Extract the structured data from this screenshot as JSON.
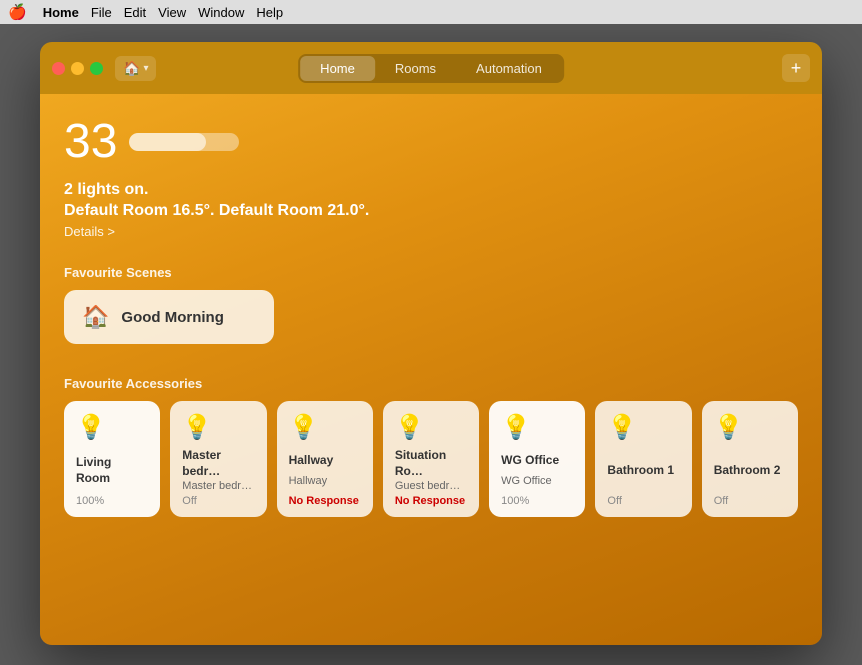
{
  "menubar": {
    "apple": "🍎",
    "items": [
      "Home",
      "File",
      "Edit",
      "View",
      "Window",
      "Help"
    ]
  },
  "window": {
    "titlebar": {
      "tabs": [
        "Home",
        "Rooms",
        "Automation"
      ],
      "active_tab": "Home",
      "add_button_label": "+",
      "home_icon": "🏠"
    },
    "header": {
      "temperature": "33",
      "status_line1": "2 lights on.",
      "status_line2": "Default Room 16.5°. Default Room 21.0°.",
      "details_link": "Details >"
    },
    "scenes": {
      "section_label": "Favourite Scenes",
      "items": [
        {
          "icon": "🏠",
          "name": "Good Morning"
        }
      ]
    },
    "accessories": {
      "section_label": "Favourite Accessories",
      "items": [
        {
          "icon": "💡",
          "icon_state": "on",
          "name": "Living Room",
          "sub": "",
          "status": "100%",
          "status_type": "normal",
          "active": true
        },
        {
          "icon": "💡",
          "icon_state": "off",
          "name": "Master bedr…",
          "sub": "Master bedr…",
          "status": "Off",
          "status_type": "normal",
          "active": false
        },
        {
          "icon": "💡",
          "icon_state": "off",
          "name": "Hallway",
          "sub": "Hallway",
          "status": "No Response",
          "status_type": "no-response",
          "active": false
        },
        {
          "icon": "💡",
          "icon_state": "off",
          "name": "Situation Ro…",
          "sub": "Guest bedr…",
          "status": "No Response",
          "status_type": "no-response",
          "active": false
        },
        {
          "icon": "💡",
          "icon_state": "on",
          "name": "WG Office",
          "sub": "WG Office",
          "status": "100%",
          "status_type": "normal",
          "active": true
        },
        {
          "icon": "💡",
          "icon_state": "off",
          "name": "Bathroom 1",
          "sub": "",
          "status": "Off",
          "status_type": "normal",
          "active": false
        },
        {
          "icon": "💡",
          "icon_state": "off",
          "name": "Bathroom 2",
          "sub": "",
          "status": "Off",
          "status_type": "normal",
          "active": false
        }
      ]
    }
  }
}
